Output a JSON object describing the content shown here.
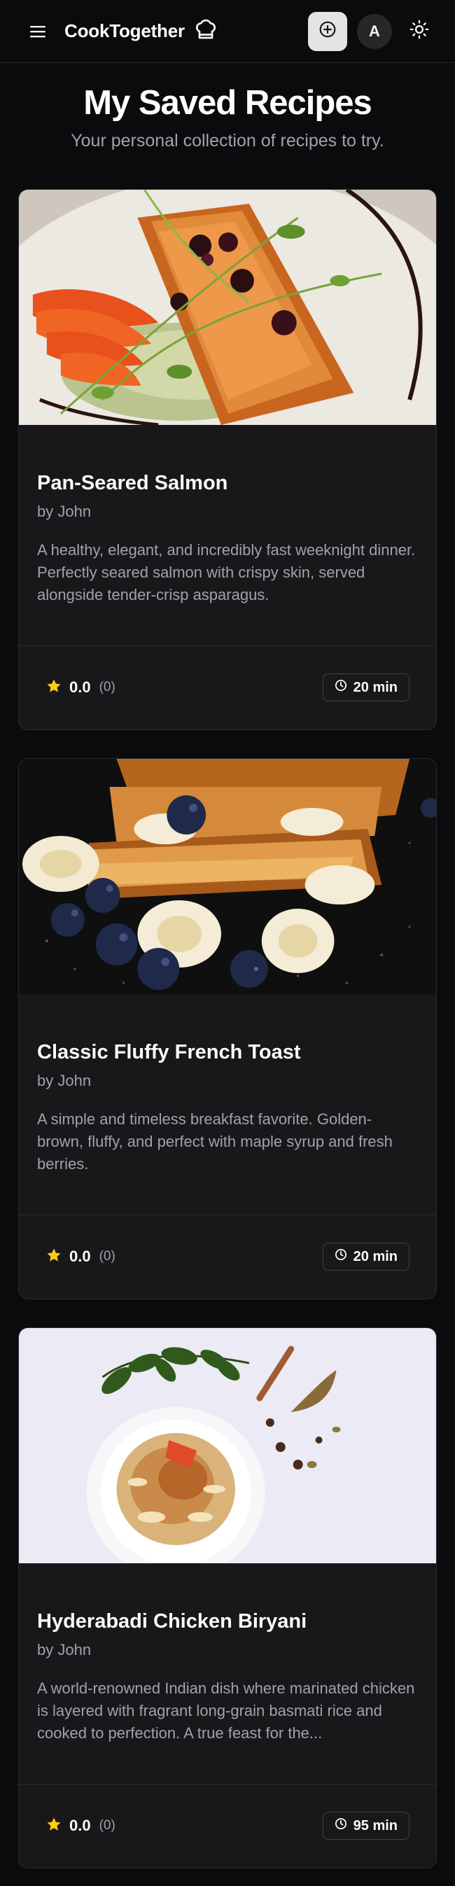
{
  "header": {
    "brand": "CookTogether",
    "avatar_initial": "A",
    "icons": {
      "menu": "hamburger-menu-icon",
      "logo": "chef-hat-icon",
      "add": "plus-circle-icon",
      "theme": "sun-icon"
    }
  },
  "page": {
    "title": "My Saved Recipes",
    "subtitle": "Your personal collection of recipes to try."
  },
  "recipes": [
    {
      "title": "Pan-Seared Salmon",
      "author": "by John",
      "description": "A healthy, elegant, and incredibly fast weeknight dinner. Perfectly seared salmon with crispy skin, served alongside tender-crisp asparagus.",
      "rating": "0.0",
      "rating_count": "(0)",
      "time": "20 min",
      "image": "salmon-dish-photo"
    },
    {
      "title": "Classic Fluffy French Toast",
      "author": "by John",
      "description": "A simple and timeless breakfast favorite. Golden-brown, fluffy, and perfect with maple syrup and fresh berries.",
      "rating": "0.0",
      "rating_count": "(0)",
      "time": "20 min",
      "image": "french-toast-photo"
    },
    {
      "title": "Hyderabadi Chicken Biryani",
      "author": "by John",
      "description": "A world-renowned Indian dish where marinated chicken is layered with fragrant long-grain basmati rice and cooked to perfection. A true feast for the...",
      "rating": "0.0",
      "rating_count": "(0)",
      "time": "95 min",
      "image": "biryani-photo"
    }
  ],
  "colors": {
    "background": "#0b0b0d",
    "card": "#18181b",
    "star": "#facc15",
    "muted_text": "#a1a1aa"
  }
}
